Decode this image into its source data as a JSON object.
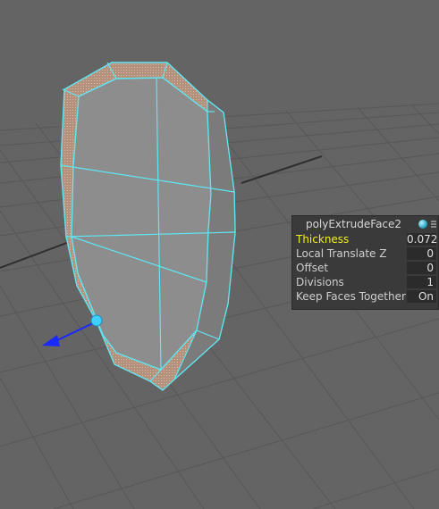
{
  "channel_box": {
    "node_name": "polyExtrudeFace2",
    "attributes": [
      {
        "label": "Thickness",
        "value": "0.072",
        "highlighted": true
      },
      {
        "label": "Local Translate Z",
        "value": "0",
        "highlighted": false
      },
      {
        "label": "Offset",
        "value": "0",
        "highlighted": false
      },
      {
        "label": "Divisions",
        "value": "1",
        "highlighted": false
      },
      {
        "label": "Keep Faces Together",
        "value": "On",
        "highlighted": false
      }
    ]
  },
  "icons": {
    "status": "sphere-status-icon",
    "grip": "panel-grip-icon",
    "manipulator": "extrude-manipulator-icon"
  },
  "colors": {
    "viewport_bg": "#646464",
    "grid_line": "#555555",
    "wireframe": "#5fe6f2",
    "face": "#8d8d8d",
    "extruded_face": "#b89480",
    "label_highlight": "#f0f020",
    "manipulator_axis": "#1a2aff"
  }
}
